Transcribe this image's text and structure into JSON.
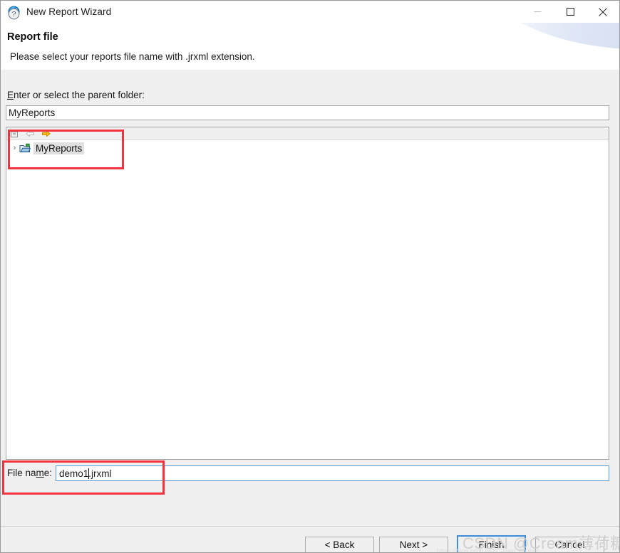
{
  "window": {
    "title": "New Report Wizard",
    "app_icon": "wizard-icon",
    "controls": {
      "minimize": "minimize-icon",
      "maximize": "maximize-icon",
      "close": "close-icon"
    }
  },
  "header": {
    "title": "Report file",
    "subtitle": "Please select your reports file name with .jrxml extension."
  },
  "form": {
    "parent_folder_label_prefix": "E",
    "parent_folder_label_rest": "nter or select the parent folder:",
    "parent_folder_value": "MyReports",
    "parent_folder_placeholder": "",
    "file_name_label_a": "File na",
    "file_name_label_u": "m",
    "file_name_label_b": "e:",
    "file_name_value": "demo1.jrxml",
    "file_name_placeholder": ""
  },
  "tree": {
    "toolbar_icons": [
      "collapse-all-icon",
      "back-arrow-icon",
      "forward-arrow-icon"
    ],
    "items": [
      {
        "label": "MyReports",
        "icon": "project-folder-icon",
        "expander": "›",
        "selected": true
      }
    ]
  },
  "footer": {
    "help": "?",
    "buttons": [
      {
        "label": "< Back",
        "name": "back-button",
        "primary": false
      },
      {
        "label": "Next >",
        "name": "next-button",
        "primary": false
      },
      {
        "label": "Finish",
        "name": "finish-button",
        "primary": true
      },
      {
        "label": "Cancel",
        "name": "cancel-button",
        "primary": false
      }
    ]
  },
  "watermark": {
    "text": "CSDN @Cream薄荷糖",
    "subtext": "https://blog.csdn.net/Cream_Cicilian"
  },
  "colors": {
    "accent": "#3f8cd9",
    "annotation": "#f5333f",
    "dialog_bg": "#f0f0f0",
    "field_bg": "#ffffff"
  }
}
